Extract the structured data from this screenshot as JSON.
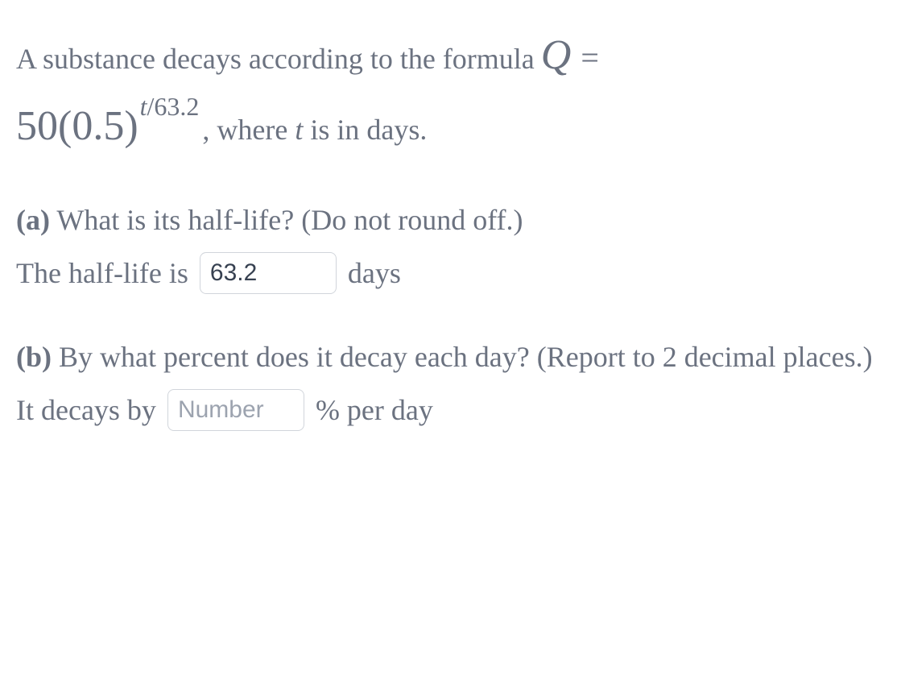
{
  "intro": {
    "text_before_formula": "A substance decays according to the formula ",
    "formula_Q": "Q",
    "formula_eq": "=",
    "formula_base": "50(0.5)",
    "formula_exp_t": "t",
    "formula_exp_rest": "/63.2",
    "text_after_formula_1": ", where ",
    "text_after_formula_t": "t",
    "text_after_formula_2": " is in days."
  },
  "part_a": {
    "label": "(a)",
    "question": " What is its half-life? (Do not round off.)",
    "answer_prefix": "The half-life is",
    "input_value": "63.2",
    "input_placeholder": "",
    "answer_suffix": "days"
  },
  "part_b": {
    "label": "(b)",
    "question": " By what percent does it decay each day? (Report to 2 decimal places.)",
    "answer_prefix": "It decays by",
    "input_value": "",
    "input_placeholder": "Number",
    "answer_suffix": "% per day"
  }
}
